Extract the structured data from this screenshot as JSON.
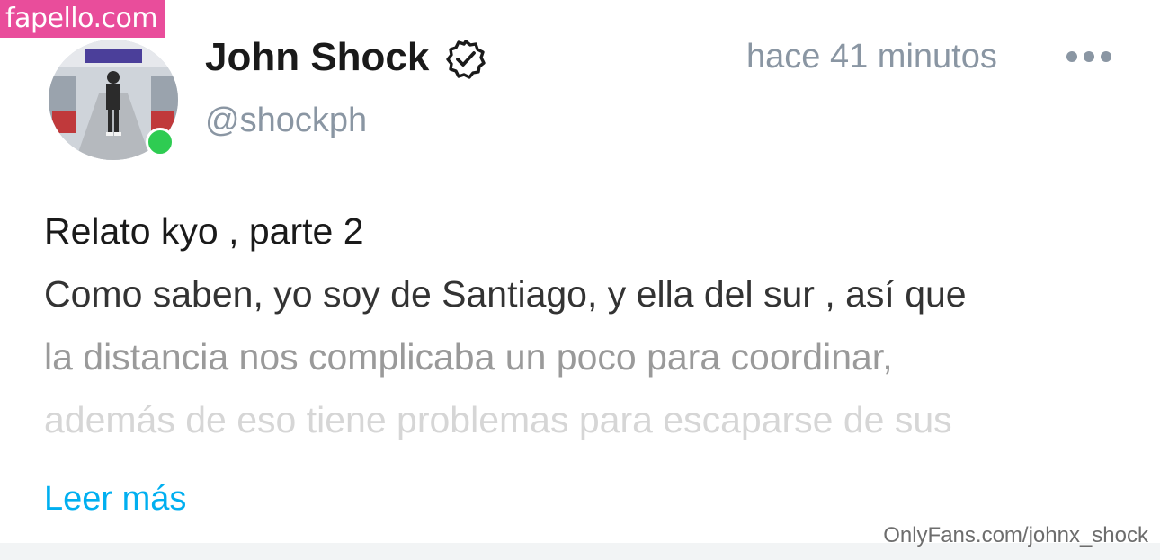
{
  "watermarks": {
    "top": "fapello.com",
    "bottom": "OnlyFans.com/johnx_shock"
  },
  "post": {
    "author": {
      "display_name": "John Shock",
      "handle": "@shockph",
      "verified_icon": "verified-badge-icon",
      "online_status": "online"
    },
    "timestamp": "hace 41 minutos",
    "more_icon": "more-options-icon",
    "text_lines": [
      "Relato kyo , parte 2",
      "Como saben, yo soy de Santiago, y ella del sur , así que",
      "la distancia nos complicaba un poco para coordinar,",
      "además de eso tiene problemas para escaparse de sus"
    ],
    "read_more": "Leer más"
  },
  "colors": {
    "accent": "#00aff0",
    "online": "#2ecc52",
    "muted": "#8a96a3",
    "watermark_bg": "#e94d9b"
  }
}
